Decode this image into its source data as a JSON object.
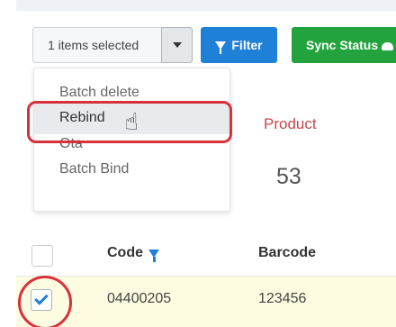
{
  "toolbar": {
    "selection_label": "1 items selected",
    "filter_label": "Filter",
    "sync_label": "Sync Status"
  },
  "menu": {
    "items": [
      {
        "label": "Batch delete"
      },
      {
        "label": "Rebind"
      },
      {
        "label": "Ota"
      },
      {
        "label": "Batch Bind"
      }
    ],
    "active_index": 1
  },
  "stats": {
    "product_label": "Product",
    "product_value": "53"
  },
  "table": {
    "columns": [
      {
        "label": "Code"
      },
      {
        "label": "Barcode"
      }
    ],
    "rows": [
      {
        "code": "04400205",
        "barcode": "123456",
        "checked": true
      }
    ]
  },
  "colors": {
    "primary": "#1f80d8",
    "success": "#22a33e",
    "highlight": "#d8313b",
    "row_selected": "#fdfbe0"
  },
  "icons": {
    "filter": "filter-funnel-icon",
    "sync": "cloud-upload-icon",
    "cursor": "hand-pointer-icon",
    "caret": "caret-down-icon",
    "sort": "filter-funnel-icon"
  }
}
